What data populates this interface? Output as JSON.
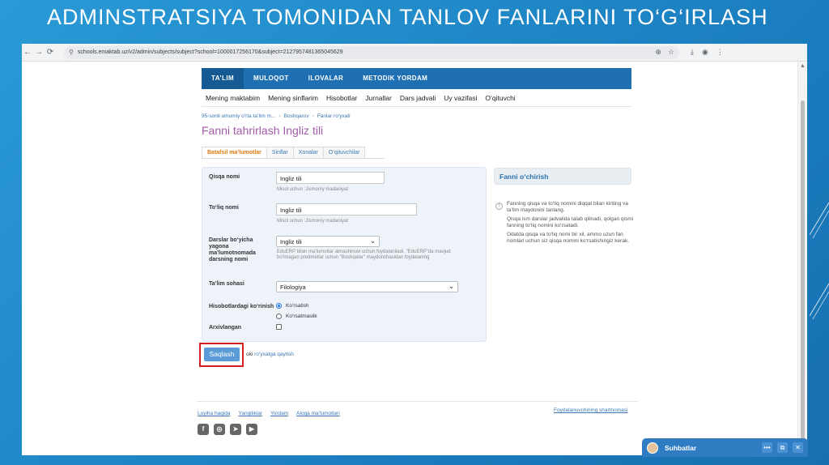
{
  "slide": {
    "title": "ADMINSTRATSIYA TOMONIDAN TANLOV FANLARINI TO‘G‘IRLASH"
  },
  "browser": {
    "url": "schools.emaktab.uz/v2/admin/subjects/subject?school=1000017256170&subject=2127957481365045629",
    "back_icon": "←",
    "forward_icon": "→",
    "reload_icon": "⟳",
    "lock_icon": "⚲",
    "star_icon": "☆",
    "zoom_icon": "⊕",
    "download_icon": "⤓",
    "profile_icon": "◉",
    "menu_icon": "⋮"
  },
  "topnav": [
    "TA’LIM",
    "MULOQOT",
    "ILOVALAR",
    "METODIK YORDAM"
  ],
  "subnav": [
    "Mening maktabim",
    "Mening sinflarim",
    "Hisobotlar",
    "Jurnallar",
    "Dars jadvali",
    "Uy vazifasi",
    "O‘qituvchi"
  ],
  "breadcrumb": [
    "95-sonli umumiy o‘rta ta’lim m...",
    "Boshqaruv",
    "Fanlar ro‘yxati"
  ],
  "page_title": "Fanni tahrirlash Ingliz tili",
  "tabs": [
    "Batafsil ma’lumotlar",
    "Sinflar",
    "Xonalar",
    "O‘qituvchilar"
  ],
  "form": {
    "short_label": "Qisqa nomi",
    "short_value": "Ingliz tili",
    "short_hint": "Misol uchun :Jismoniy madaniyat",
    "full_label": "To‘liq nomi",
    "full_value": "Ingliz tili",
    "full_hint": "Misol uchun :Jismoniy madaniyat",
    "single_label": "Darslar bo‘yicha yagona ma’lumotnomada darsning nomi",
    "single_value": "Ingliz tili",
    "single_hint": "EduERP bilan ma’lumotlar almashinuvi uchun foydalaniladi. \"EduERP\"da mavjud bo‘lmagan predmetlar uchun \"Boshqalar\" maydonchasidan foydalaning",
    "area_label": "Ta’lim sohasi",
    "area_value": "Filologiya",
    "display_label": "Hisobotlardagi ko‘rinish",
    "display_show": "Ko‘rsatish",
    "display_hide": "Ko‘rsatmaslik",
    "archived_label": "Arxivlangan",
    "dropdown_arrow": "⌄"
  },
  "actions": {
    "save": "Saqlash",
    "or": "oki",
    "back_link": "ro‘yxatga qaytish"
  },
  "side": {
    "delete_title": "Fanni o‘chirish",
    "info_icon": "?",
    "info_paragraphs": [
      "Fanning qisqa va to‘liq nomini diqqat bilan kiriting va ta’lim maydonini tanlang.",
      "Qisqa ism darslar jadvalida talab qilinadi, qolgan qismi fanning to‘liq nomini ko‘rsatadi.",
      "Odatda qisqa va to‘liq nomi bir xil, ammo uzun fan nomlari uchun siz qisqa nomini ko‘rsatishingiz kerak."
    ]
  },
  "footer": {
    "links": [
      "Loyiha haqida",
      "Yangiliklar",
      "Yordam",
      "Aloqa ma’lumotlari"
    ],
    "agreement": "Foydalanuvchining shartnomasi",
    "social": [
      "f",
      "◎",
      "➤",
      "▶"
    ]
  },
  "chat": {
    "title": "Suhbatlar",
    "more_icon": "•••",
    "popout_icon": "⧉",
    "close_icon": "✕"
  }
}
